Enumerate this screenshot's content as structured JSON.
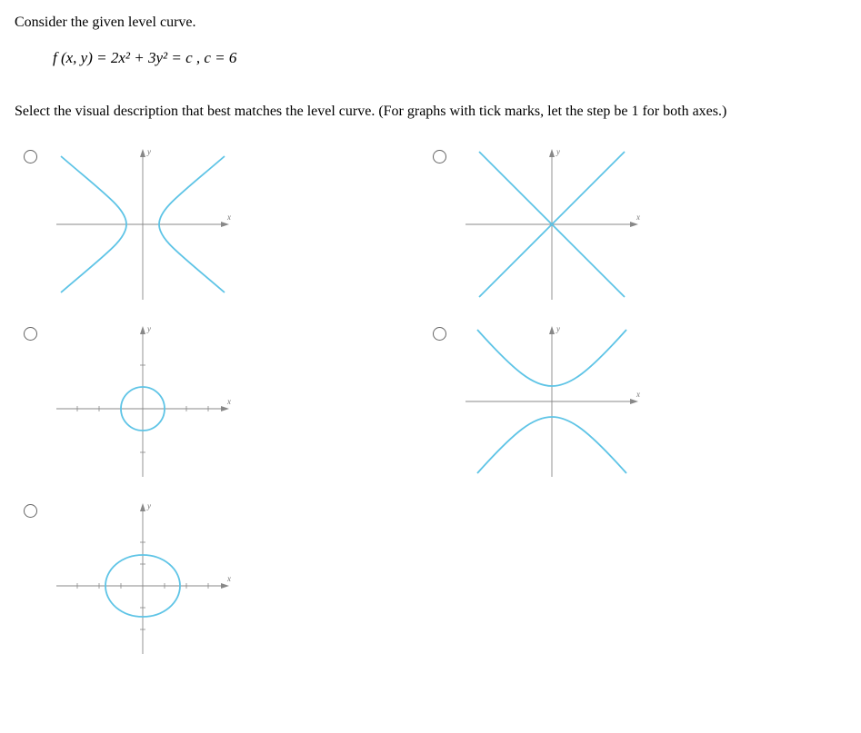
{
  "question": {
    "prompt_line1": "Consider the given level curve.",
    "equation": "f (x, y) = 2x² + 3y² = c , c = 6",
    "prompt_line2": "Select the visual description that best matches the level curve. (For graphs with tick marks, let the step be 1 for both axes.)"
  },
  "options": [
    {
      "id": "A",
      "alt": "hyperbola-opening-left-right"
    },
    {
      "id": "B",
      "alt": "intersecting-lines-x"
    },
    {
      "id": "C",
      "alt": "small-circle-centered"
    },
    {
      "id": "D",
      "alt": "hyperbola-opening-up-down"
    },
    {
      "id": "E",
      "alt": "ellipse-wider-than-tall"
    }
  ],
  "axis_labels": {
    "x": "x",
    "y": "y"
  },
  "chart_data": {
    "type": "other",
    "description": "Five small coordinate-plane option graphs for a multiple-choice calculus question about the level curve 2x^2 + 3y^2 = 6.",
    "axes_step": 1,
    "options": [
      {
        "id": "A",
        "position": "row1-col1",
        "curve_type": "hyperbola",
        "orientation": "opens left and right",
        "vertices_approx": [
          [
            -1,
            0
          ],
          [
            1,
            0
          ]
        ],
        "tick_marks": false
      },
      {
        "id": "B",
        "position": "row1-col2",
        "curve_type": "pair of intersecting lines",
        "lines_slopes_approx": [
          1,
          -1
        ],
        "through_origin": true,
        "tick_marks": false
      },
      {
        "id": "C",
        "position": "row2-col1",
        "curve_type": "circle",
        "center": [
          0,
          0
        ],
        "radius_approx": 1,
        "tick_marks": true,
        "x_ticks": [
          -3,
          -2,
          -1,
          1,
          2,
          3
        ],
        "y_ticks": [
          -2,
          -1,
          1,
          2
        ]
      },
      {
        "id": "D",
        "position": "row2-col2",
        "curve_type": "hyperbola",
        "orientation": "opens up and down",
        "vertices_approx": [
          [
            0,
            -1
          ],
          [
            0,
            1
          ]
        ],
        "tick_marks": false
      },
      {
        "id": "E",
        "position": "row3-col1",
        "curve_type": "ellipse",
        "center": [
          0,
          0
        ],
        "semi_axis_x_approx": 1.73,
        "semi_axis_y_approx": 1.41,
        "tick_marks": true,
        "x_ticks": [
          -3,
          -2,
          -1,
          1,
          2,
          3
        ],
        "y_ticks": [
          -2,
          -1,
          1,
          2
        ]
      }
    ]
  }
}
